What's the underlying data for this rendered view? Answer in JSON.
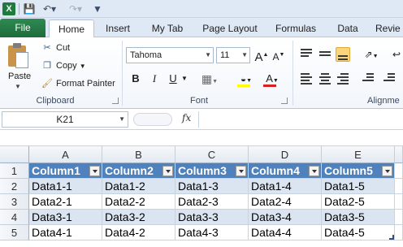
{
  "qat": {
    "app_icon": "excel-icon",
    "icons": [
      "save-icon",
      "undo-icon",
      "redo-icon",
      "customize-qat-icon"
    ]
  },
  "tabs": {
    "file": "File",
    "items": [
      "Home",
      "Insert",
      "My Tab",
      "Page Layout",
      "Formulas",
      "Data",
      "Revie"
    ],
    "active": "Home"
  },
  "ribbon": {
    "clipboard": {
      "label": "Clipboard",
      "paste": "Paste",
      "cut": "Cut",
      "copy": "Copy",
      "format_painter": "Format Painter"
    },
    "font": {
      "label": "Font",
      "font_name": "Tahoma",
      "font_size": "11",
      "bold": "B",
      "italic": "I",
      "underline": "U",
      "grow": "A",
      "shrink": "A",
      "font_color": "A",
      "fill_color_hex": "#ffff00",
      "font_color_hex": "#d92020"
    },
    "alignment": {
      "label": "Alignme"
    }
  },
  "formula_bar": {
    "name_box": "K21",
    "fx": "fx",
    "formula": ""
  },
  "sheet": {
    "columns": [
      "A",
      "B",
      "C",
      "D",
      "E"
    ],
    "rows": [
      "1",
      "2",
      "3",
      "4",
      "5"
    ],
    "header_color": "#4f81bd",
    "band_color": "#dbe5f1",
    "table": {
      "headers": [
        "Column1",
        "Column2",
        "Column3",
        "Column4",
        "Column5"
      ],
      "data": [
        [
          "Data1-1",
          "Data1-2",
          "Data1-3",
          "Data1-4",
          "Data1-5"
        ],
        [
          "Data2-1",
          "Data2-2",
          "Data2-3",
          "Data2-4",
          "Data2-5"
        ],
        [
          "Data3-1",
          "Data3-2",
          "Data3-3",
          "Data3-4",
          "Data3-5"
        ],
        [
          "Data4-1",
          "Data4-2",
          "Data4-3",
          "Data4-4",
          "Data4-5"
        ]
      ]
    }
  }
}
